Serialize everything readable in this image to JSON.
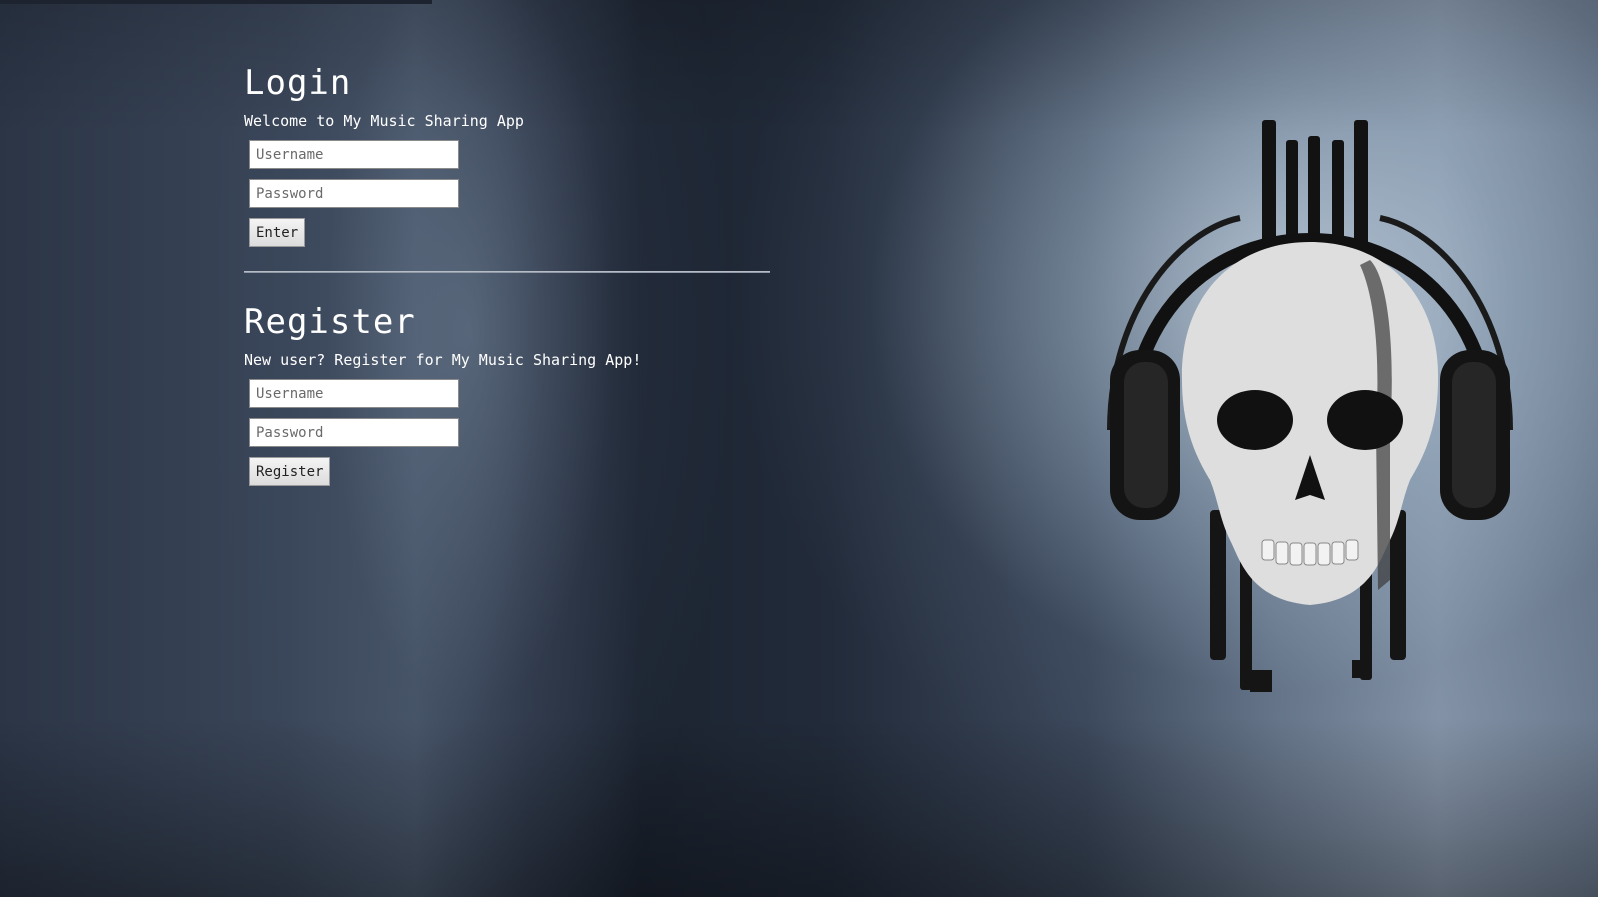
{
  "login": {
    "title": "Login",
    "subtitle": "Welcome to My Music Sharing App",
    "username_placeholder": "Username",
    "password_placeholder": "Password",
    "submit_label": "Enter"
  },
  "register": {
    "title": "Register",
    "subtitle": "New user? Register for My Music Sharing App!",
    "username_placeholder": "Username",
    "password_placeholder": "Password",
    "submit_label": "Register"
  },
  "background": {
    "artwork_icon": "skull-with-headphones-icon"
  },
  "colors": {
    "text": "#ffffff",
    "background_dark": "#1c2431",
    "background_light": "#8796aa"
  }
}
